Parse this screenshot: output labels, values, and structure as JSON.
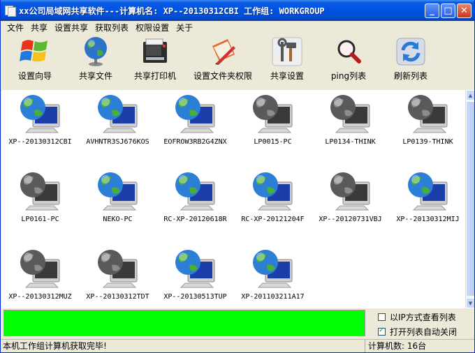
{
  "window": {
    "title": "xx公司局域网共享软件---计算机名: XP--20130312CBI   工作组: WORKGROUP",
    "minimize": "_",
    "maximize": "□",
    "close": "✕"
  },
  "menu": [
    "文件",
    "共享",
    "设置共享",
    "获取列表",
    "权限设置",
    "关于"
  ],
  "toolbar": [
    {
      "label": "设置向导",
      "icon": "windows-flag-icon"
    },
    {
      "label": "共享文件",
      "icon": "globe-icon"
    },
    {
      "label": "共享打印机",
      "icon": "printer-icon"
    },
    {
      "label": "设置文件夹权限",
      "icon": "notebook-pen-icon"
    },
    {
      "label": "共享设置",
      "icon": "tools-icon"
    },
    {
      "label": "ping列表",
      "icon": "magnifier-icon"
    },
    {
      "label": "刷新列表",
      "icon": "refresh-icon"
    }
  ],
  "computers": [
    {
      "name": "XP--20130312CBI",
      "status": "online"
    },
    {
      "name": "AVHNTR3SJ676KOS",
      "status": "online"
    },
    {
      "name": "EOFROW3RB2G4ZNX",
      "status": "online"
    },
    {
      "name": "LP0015-PC",
      "status": "offline"
    },
    {
      "name": "LP0134-THINK",
      "status": "offline"
    },
    {
      "name": "LP0139-THINK",
      "status": "offline"
    },
    {
      "name": "LP0161-PC",
      "status": "offline"
    },
    {
      "name": "NEKO-PC",
      "status": "online"
    },
    {
      "name": "RC-XP-20120618R",
      "status": "online"
    },
    {
      "name": "RC-XP-20121204F",
      "status": "online"
    },
    {
      "name": "XP--20120731VBJ",
      "status": "offline"
    },
    {
      "name": "XP--20130312MIJ",
      "status": "online"
    },
    {
      "name": "XP--20130312MUZ",
      "status": "offline"
    },
    {
      "name": "XP--20130312TDT",
      "status": "offline"
    },
    {
      "name": "XP--20130513TUP",
      "status": "online"
    },
    {
      "name": "XP-201103211A17",
      "status": "online"
    }
  ],
  "progress": {
    "value": 100,
    "color": "#00ff00"
  },
  "options": {
    "by_ip": {
      "label": "以IP方式查看列表",
      "checked": false
    },
    "auto_close": {
      "label": "打开列表自动关闭",
      "checked": true
    }
  },
  "status": {
    "message": "本机工作组计算机获取完毕!",
    "count": "计算机数: 16台"
  }
}
